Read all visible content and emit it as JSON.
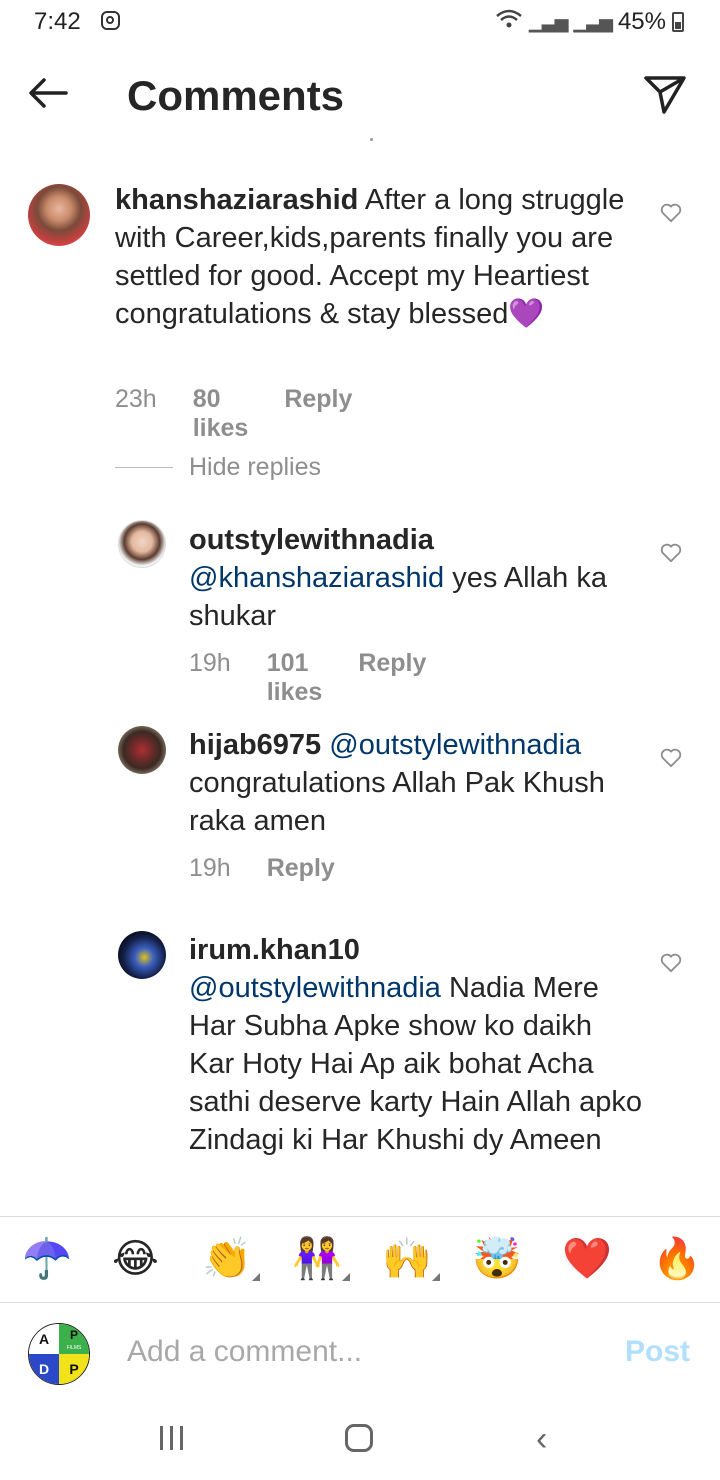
{
  "status_bar": {
    "time": "7:42",
    "battery": "45%"
  },
  "header": {
    "title": "Comments",
    "back_icon": "arrow-left-icon",
    "share_icon": "paper-plane-icon"
  },
  "comments": [
    {
      "username": "khanshaziarashid",
      "text": " After a long struggle with Career,kids,parents finally you are settled for good. Accept my Heartiest congratulations & stay blessed",
      "emoji": "💜",
      "time": "23h",
      "likes": "80 likes",
      "reply": "Reply"
    }
  ],
  "hide_replies": "Hide replies",
  "replies": [
    {
      "username": "outstylewithnadia",
      "mention": "@khanshaziarashid",
      "text": " yes Allah ka shukar",
      "time": "19h",
      "likes": "101 likes",
      "reply": "Reply"
    },
    {
      "username": "hijab6975",
      "mention": "@outstylewithnadia",
      "text": "congratulations Allah Pak Khush raka amen",
      "time": "19h",
      "reply": "Reply"
    },
    {
      "username": "irum.khan10",
      "mention": "@outstylewithnadia",
      "text": " Nadia Mere Har Subha Apke show ko daikh Kar Hoty Hai Ap aik bohat Acha sathi deserve karty Hain Allah apko Zindagi ki Har Khushi dy Ameen"
    }
  ],
  "emoji_bar": [
    "☂️",
    "😂",
    "👏",
    "👭",
    "🙌",
    "🤯",
    "❤️",
    "🔥"
  ],
  "composer": {
    "placeholder": "Add a comment...",
    "post_label": "Post",
    "avatar_letters": [
      "A",
      "P",
      "D",
      "P"
    ],
    "avatar_small_text": "FILMS"
  },
  "colors": {
    "mention": "#00376b",
    "post_disabled": "#b2dffc",
    "meta": "#8e8e8e"
  }
}
